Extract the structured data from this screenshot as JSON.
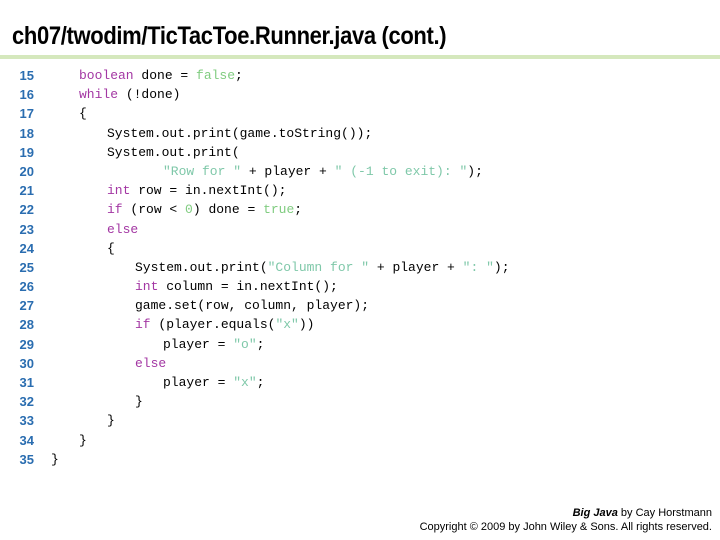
{
  "slide": {
    "title": "ch07/twodim/TicTacToe.Runner.java (cont.)",
    "divider_color": "#d5e8bd"
  },
  "colors": {
    "lineno": "#2a6db0",
    "keyword": "#a337a3",
    "literal": "#80cc80",
    "string": "#7fc8a9",
    "plain": "#000000"
  },
  "code": {
    "language": "java",
    "first_line_number": 15,
    "lines": [
      {
        "n": "15",
        "indent": 5,
        "tokens": [
          {
            "t": "boolean",
            "c": "kw"
          },
          {
            "t": " done = ",
            "c": "plain"
          },
          {
            "t": "false",
            "c": "lit"
          },
          {
            "t": ";",
            "c": "plain"
          }
        ]
      },
      {
        "n": "16",
        "indent": 5,
        "tokens": [
          {
            "t": "while",
            "c": "kw"
          },
          {
            "t": " (!done)",
            "c": "plain"
          }
        ]
      },
      {
        "n": "17",
        "indent": 5,
        "tokens": [
          {
            "t": "{",
            "c": "plain"
          }
        ]
      },
      {
        "n": "18",
        "indent": 9,
        "tokens": [
          {
            "t": "System.out.print(game.toString());",
            "c": "plain"
          }
        ]
      },
      {
        "n": "19",
        "indent": 9,
        "tokens": [
          {
            "t": "System.out.print(",
            "c": "plain"
          }
        ]
      },
      {
        "n": "20",
        "indent": 17,
        "tokens": [
          {
            "t": "\"Row for \"",
            "c": "str"
          },
          {
            "t": " + player + ",
            "c": "plain"
          },
          {
            "t": "\" (-1 to exit): \"",
            "c": "str"
          },
          {
            "t": ");",
            "c": "plain"
          }
        ]
      },
      {
        "n": "21",
        "indent": 9,
        "tokens": [
          {
            "t": "int",
            "c": "kw"
          },
          {
            "t": " row = in.nextInt();",
            "c": "plain"
          }
        ]
      },
      {
        "n": "22",
        "indent": 9,
        "tokens": [
          {
            "t": "if",
            "c": "kw"
          },
          {
            "t": " (row < ",
            "c": "plain"
          },
          {
            "t": "0",
            "c": "lit"
          },
          {
            "t": ") done = ",
            "c": "plain"
          },
          {
            "t": "true",
            "c": "lit"
          },
          {
            "t": ";",
            "c": "plain"
          }
        ]
      },
      {
        "n": "23",
        "indent": 9,
        "tokens": [
          {
            "t": "else",
            "c": "kw"
          }
        ]
      },
      {
        "n": "24",
        "indent": 9,
        "tokens": [
          {
            "t": "{",
            "c": "plain"
          }
        ]
      },
      {
        "n": "25",
        "indent": 13,
        "tokens": [
          {
            "t": "System.out.print(",
            "c": "plain"
          },
          {
            "t": "\"Column for \"",
            "c": "str"
          },
          {
            "t": " + player + ",
            "c": "plain"
          },
          {
            "t": "\": \"",
            "c": "str"
          },
          {
            "t": ");",
            "c": "plain"
          }
        ]
      },
      {
        "n": "26",
        "indent": 13,
        "tokens": [
          {
            "t": "int",
            "c": "kw"
          },
          {
            "t": " column = in.nextInt();",
            "c": "plain"
          }
        ]
      },
      {
        "n": "27",
        "indent": 13,
        "tokens": [
          {
            "t": "game.set(row, column, player);",
            "c": "plain"
          }
        ]
      },
      {
        "n": "28",
        "indent": 13,
        "tokens": [
          {
            "t": "if",
            "c": "kw"
          },
          {
            "t": " (player.equals(",
            "c": "plain"
          },
          {
            "t": "\"x\"",
            "c": "str"
          },
          {
            "t": "))",
            "c": "plain"
          }
        ]
      },
      {
        "n": "29",
        "indent": 17,
        "tokens": [
          {
            "t": "player = ",
            "c": "plain"
          },
          {
            "t": "\"o\"",
            "c": "str"
          },
          {
            "t": ";",
            "c": "plain"
          }
        ]
      },
      {
        "n": "30",
        "indent": 13,
        "tokens": [
          {
            "t": "else",
            "c": "kw"
          }
        ]
      },
      {
        "n": "31",
        "indent": 17,
        "tokens": [
          {
            "t": "player = ",
            "c": "plain"
          },
          {
            "t": "\"x\"",
            "c": "str"
          },
          {
            "t": ";",
            "c": "plain"
          }
        ]
      },
      {
        "n": "32",
        "indent": 13,
        "tokens": [
          {
            "t": "}",
            "c": "plain"
          }
        ]
      },
      {
        "n": "33",
        "indent": 9,
        "tokens": [
          {
            "t": "}",
            "c": "plain"
          }
        ]
      },
      {
        "n": "34",
        "indent": 5,
        "tokens": [
          {
            "t": "}",
            "c": "plain"
          }
        ]
      },
      {
        "n": "35",
        "indent": 1,
        "tokens": [
          {
            "t": "}",
            "c": "plain"
          }
        ]
      }
    ]
  },
  "footer": {
    "line1_em": "Big Java",
    "line1_rest": " by Cay Horstmann",
    "line2": "Copyright © 2009 by John Wiley & Sons.  All rights reserved."
  }
}
